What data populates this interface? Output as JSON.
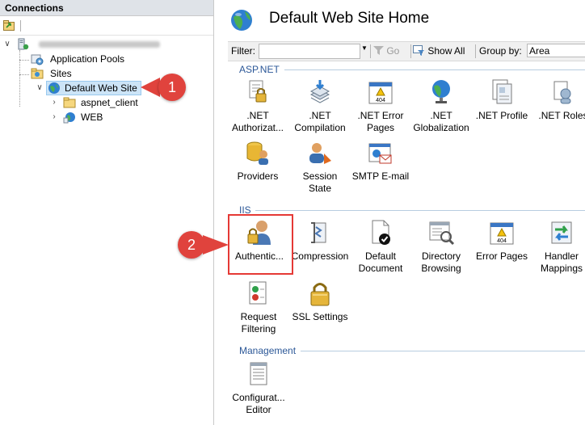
{
  "connections": {
    "title": "Connections",
    "tree": {
      "application_pools": "Application Pools",
      "sites": "Sites",
      "default_web_site": "Default Web Site",
      "aspnet_client": "aspnet_client",
      "web": "WEB"
    }
  },
  "main": {
    "title": "Default Web Site Home",
    "filter": {
      "label": "Filter:",
      "go": "Go",
      "show_all": "Show All",
      "group_by_label": "Group by:",
      "group_by_value": "Area"
    },
    "sections": {
      "aspnet": {
        "label": "ASP.NET",
        "items": [
          {
            "line1": ".NET",
            "line2": "Authorizat..."
          },
          {
            "line1": ".NET",
            "line2": "Compilation"
          },
          {
            "line1": ".NET Error",
            "line2": "Pages"
          },
          {
            "line1": ".NET",
            "line2": "Globalization"
          },
          {
            "line1": ".NET Profile",
            "line2": ""
          },
          {
            "line1": ".NET Roles",
            "line2": ""
          },
          {
            "line1": "Providers",
            "line2": ""
          },
          {
            "line1": "Session State",
            "line2": ""
          },
          {
            "line1": "SMTP E-mail",
            "line2": ""
          }
        ]
      },
      "iis": {
        "label": "IIS",
        "items": [
          {
            "line1": "Authentic...",
            "line2": ""
          },
          {
            "line1": "Compression",
            "line2": ""
          },
          {
            "line1": "Default",
            "line2": "Document"
          },
          {
            "line1": "Directory",
            "line2": "Browsing"
          },
          {
            "line1": "Error Pages",
            "line2": ""
          },
          {
            "line1": "Handler",
            "line2": "Mappings"
          },
          {
            "line1": "Request",
            "line2": "Filtering"
          },
          {
            "line1": "SSL Settings",
            "line2": ""
          }
        ]
      },
      "management": {
        "label": "Management",
        "items": [
          {
            "line1": "Configurat...",
            "line2": "Editor"
          }
        ]
      }
    }
  },
  "callouts": {
    "one": "1",
    "two": "2"
  },
  "colors": {
    "section_text": "#2b5797",
    "callout": "#e0433d",
    "highlight_border": "#e53935",
    "selected_node": "#cce4f7"
  }
}
